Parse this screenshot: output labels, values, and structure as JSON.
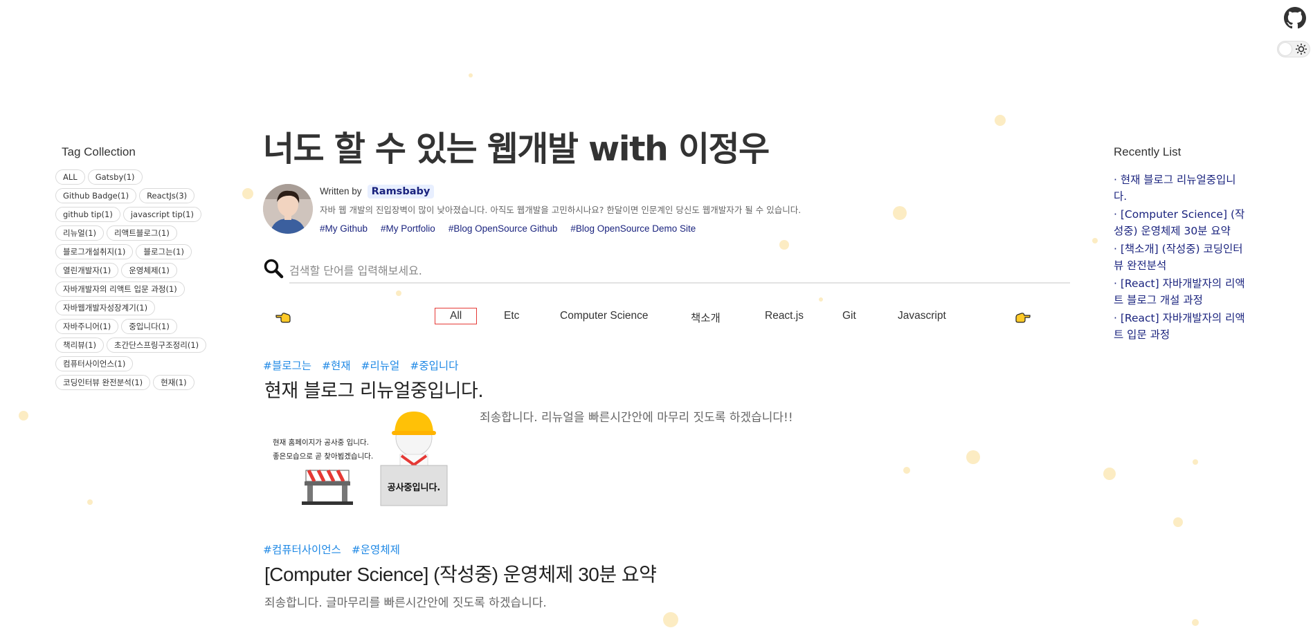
{
  "header": {
    "github_icon": "github-icon",
    "theme_toggle_icon": "sun-icon"
  },
  "tags": {
    "title": "Tag Collection",
    "items": [
      "ALL",
      "Gatsby(1)",
      "Github Badge(1)",
      "ReactJs(3)",
      "github tip(1)",
      "javascript tip(1)",
      "리뉴얼(1)",
      "리액트블로그(1)",
      "블로그개설취지(1)",
      "블로그는(1)",
      "열린개발자(1)",
      "운영체제(1)",
      "자바개발자의 리액트 입문 과정(1)",
      "자바웹개발자성장계기(1)",
      "자바주니어(1)",
      "중입니다(1)",
      "책리뷰(1)",
      "초간단스프링구조정리(1)",
      "컴퓨터사이언스(1)",
      "코딩인터뷰 완전분석(1)",
      "현재(1)"
    ]
  },
  "blog": {
    "title": "너도 할 수 있는 웹개발 with 이정우",
    "written_by": "Written by",
    "author": "Ramsbaby",
    "description": "자바 웹 개발의 진입장벽이 많이 낮아졌습니다. 아직도 웹개발을 고민하시나요? 한달이면 인문계인 당신도 웹개발자가 될 수 있습니다.",
    "links": [
      "#My Github",
      "#My Portfolio",
      "#Blog OpenSource Github",
      "#Blog OpenSource Demo Site"
    ]
  },
  "search": {
    "placeholder": "검색할 단어를 입력해보세요.",
    "value": ""
  },
  "categories": {
    "active": "All",
    "items": [
      "All",
      "Etc",
      "Computer Science",
      "책소개",
      "React.js",
      "Git",
      "Javascript"
    ]
  },
  "posts": [
    {
      "tags": [
        "#블로그는",
        "#현재",
        "#리뉴얼",
        "#중입니다"
      ],
      "title": "현재 블로그 리뉴얼중입니다.",
      "excerpt": "죄송합니다. 리뉴얼을 빠른시간안에 마무리 짓도록 하겠습니다!!",
      "thumbnail": {
        "line1": "현재 홈페이지가 공사중 입니다.",
        "line2": "좋은모습으로 곧 찾아뵙겠습니다.",
        "sign": "공사중입니다."
      }
    },
    {
      "tags": [
        "#컴퓨터사이언스",
        "#운영체제"
      ],
      "title": "[Computer Science] (작성중) 운영체제 30분 요약",
      "excerpt": "죄송합니다. 글마무리를 빠른시간안에 짓도록 하겠습니다."
    }
  ],
  "recent": {
    "title": "Recently List",
    "items": [
      "· 현재 블로그 리뉴얼중입니다.",
      "· [Computer Science] (작성중) 운영체제 30분 요약",
      "· [책소개] (작성중) 코딩인터뷰 완전분석",
      "· [React] 자바개발자의 리액트 블로그 개설 과정",
      "· [React] 자바개발자의 리액트 입문 과정"
    ]
  },
  "colors": {
    "accent_link": "#1a237e",
    "tag_blue": "#1e88e5",
    "active_category_border": "#e53935",
    "background_dot": "#fbe9b8"
  }
}
